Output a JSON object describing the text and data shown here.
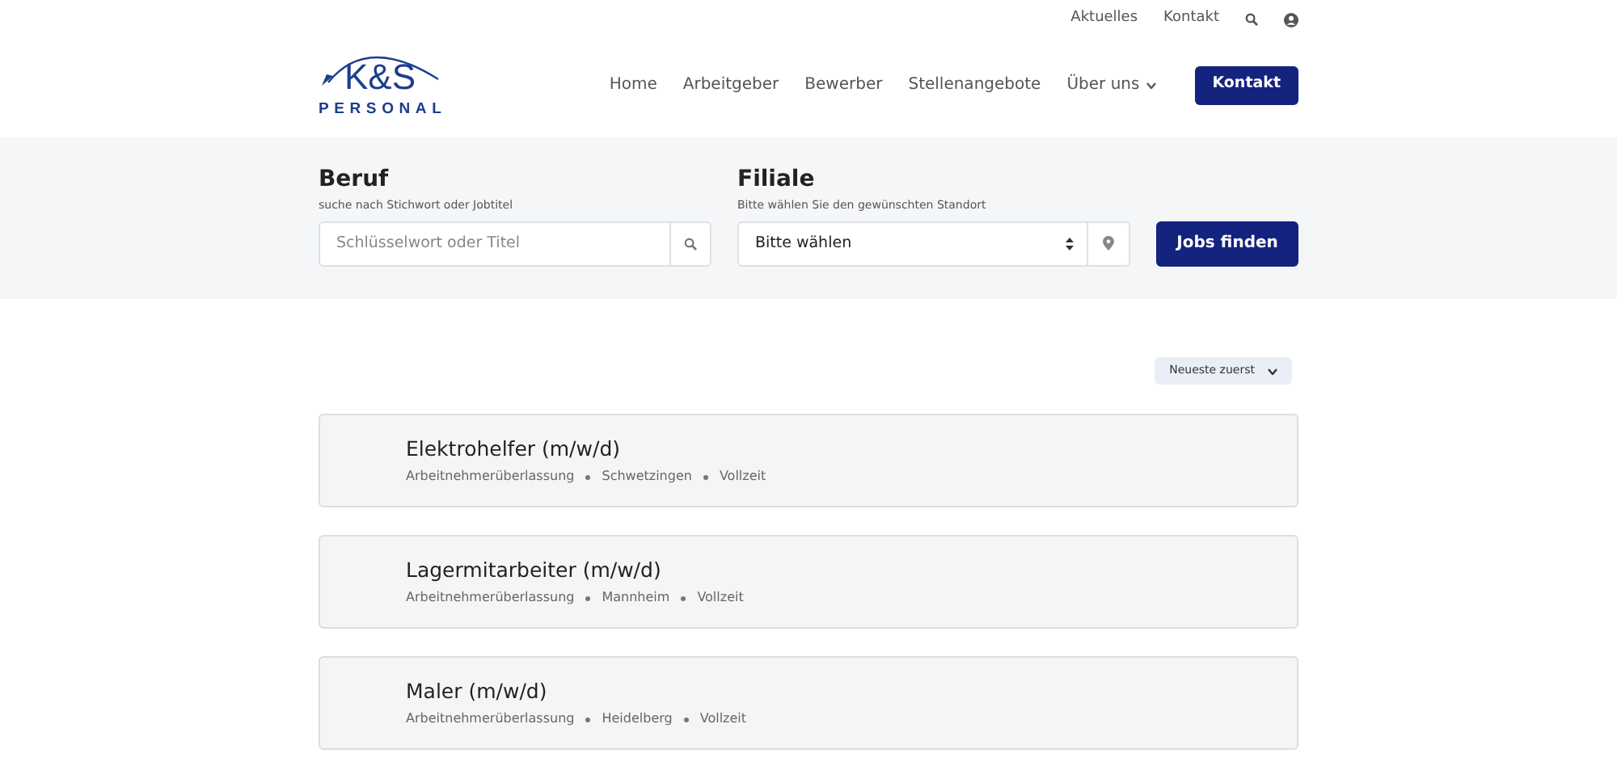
{
  "logo": {
    "initials": "K&S",
    "wordmark": "PERSONAL"
  },
  "top_links": [
    "Aktuelles",
    "Kontakt"
  ],
  "nav": [
    {
      "label": "Home",
      "dropdown": false
    },
    {
      "label": "Arbeitgeber",
      "dropdown": false
    },
    {
      "label": "Bewerber",
      "dropdown": false
    },
    {
      "label": "Stellenangebote",
      "dropdown": false
    },
    {
      "label": "Über uns",
      "dropdown": true
    }
  ],
  "nav_button": "Kontakt",
  "search": {
    "job": {
      "title": "Beruf",
      "hint": "suche nach Stichwort oder Jobtitel",
      "placeholder": "Schlüsselwort oder Titel"
    },
    "branch": {
      "title": "Filiale",
      "hint": "Bitte wählen Sie den gewünschten Standort",
      "value": "Bitte wählen"
    },
    "button": "Jobs finden"
  },
  "sort": "Neueste zuerst",
  "jobs": [
    {
      "title": "Elektrohelfer (m/w/d)",
      "meta": [
        "Arbeitnehmerüberlassung",
        "Schwetzingen",
        "Vollzeit"
      ]
    },
    {
      "title": "Lagermitarbeiter (m/w/d)",
      "meta": [
        "Arbeitnehmerüberlassung",
        "Mannheim",
        "Vollzeit"
      ]
    },
    {
      "title": "Maler (m/w/d)",
      "meta": [
        "Arbeitnehmerüberlassung",
        "Heidelberg",
        "Vollzeit"
      ]
    }
  ]
}
